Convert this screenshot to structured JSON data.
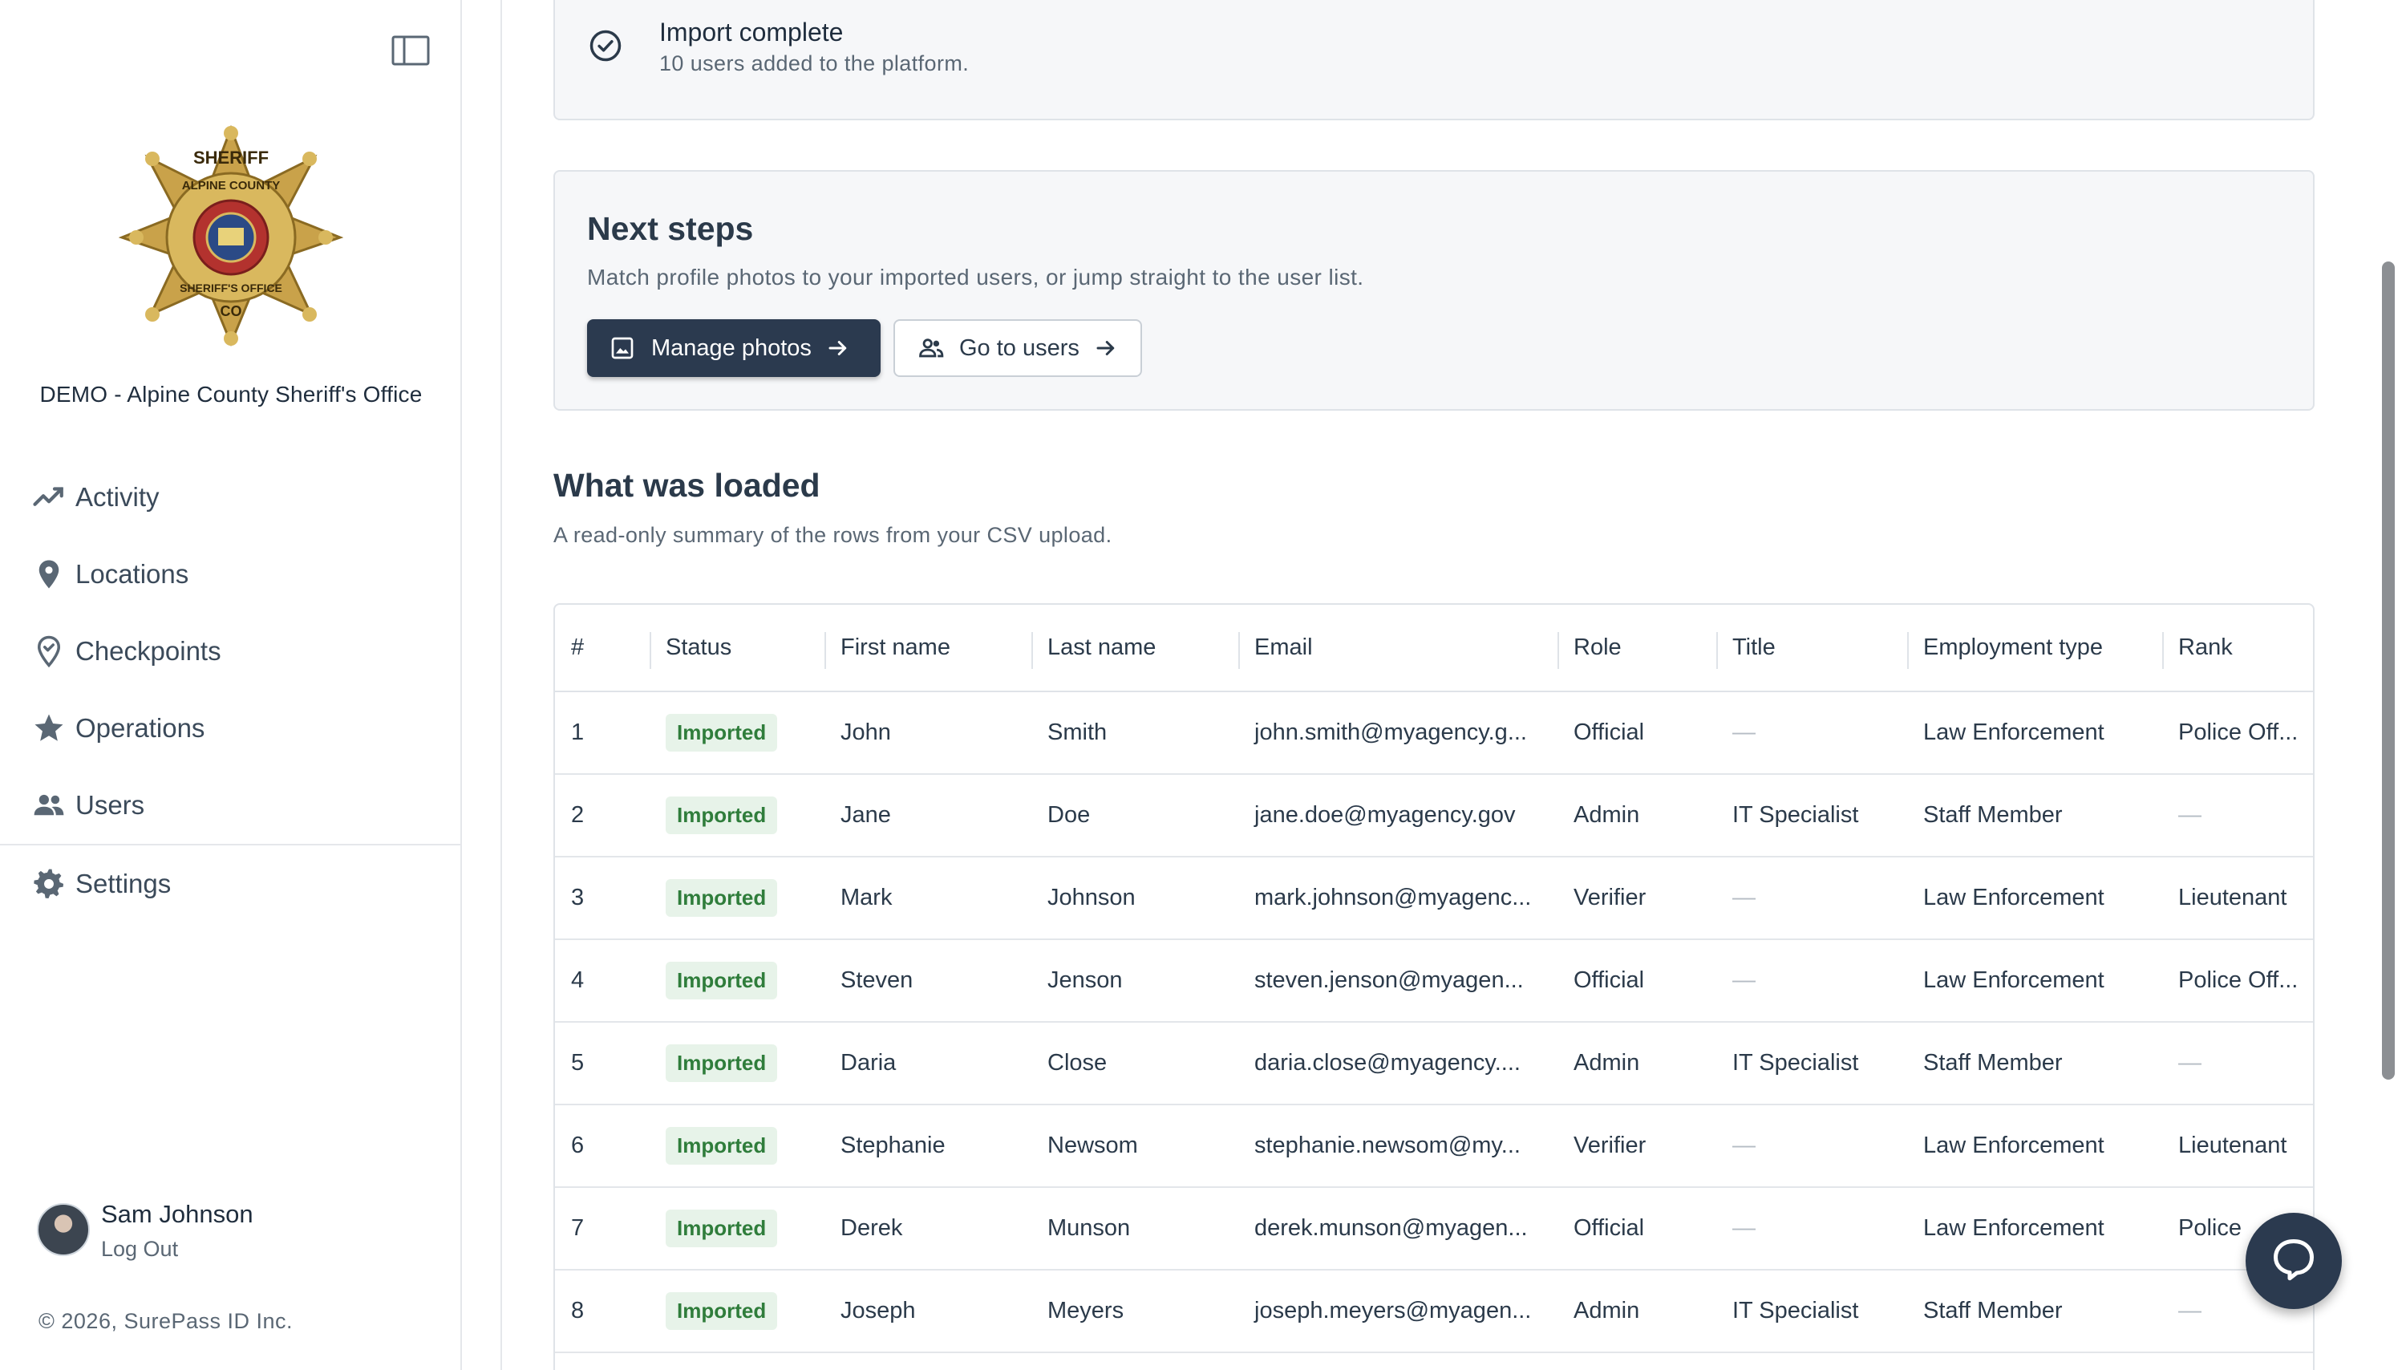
{
  "sidebar": {
    "org_name": "DEMO - Alpine County Sheriff's Office",
    "badge": {
      "top_text": "SHERIFF",
      "county": "ALPINE COUNTY",
      "office": "SHERIFF'S OFFICE",
      "state": "CO"
    },
    "nav": [
      {
        "label": "Activity",
        "icon": "activity-icon"
      },
      {
        "label": "Locations",
        "icon": "location-pin-icon"
      },
      {
        "label": "Checkpoints",
        "icon": "checkpoint-pin-icon"
      },
      {
        "label": "Operations",
        "icon": "star-icon"
      },
      {
        "label": "Users",
        "icon": "users-icon"
      },
      {
        "label": "Settings",
        "icon": "gear-icon"
      }
    ],
    "user": {
      "name": "Sam Johnson",
      "logout": "Log Out"
    },
    "copyright": "© 2026, SurePass ID Inc."
  },
  "import_status": {
    "title": "Import complete",
    "subtitle": "10 users added to the platform."
  },
  "next_steps": {
    "title": "Next steps",
    "subtitle": "Match profile photos to your imported users, or jump straight to the user list.",
    "primary_button": "Manage photos",
    "secondary_button": "Go to users"
  },
  "loaded": {
    "title": "What was loaded",
    "subtitle": "A read-only summary of the rows from your CSV upload."
  },
  "table": {
    "columns": [
      "#",
      "Status",
      "First name",
      "Last name",
      "Email",
      "Role",
      "Title",
      "Employment type",
      "Rank"
    ],
    "rows": [
      [
        "1",
        "Imported",
        "John",
        "Smith",
        "john.smith@myagency.g...",
        "Official",
        "—",
        "Law Enforcement",
        "Police Off..."
      ],
      [
        "2",
        "Imported",
        "Jane",
        "Doe",
        "jane.doe@myagency.gov",
        "Admin",
        "IT Specialist",
        "Staff Member",
        "—"
      ],
      [
        "3",
        "Imported",
        "Mark",
        "Johnson",
        "mark.johnson@myagenc...",
        "Verifier",
        "—",
        "Law Enforcement",
        "Lieutenant"
      ],
      [
        "4",
        "Imported",
        "Steven",
        "Jenson",
        "steven.jenson@myagen...",
        "Official",
        "—",
        "Law Enforcement",
        "Police Off..."
      ],
      [
        "5",
        "Imported",
        "Daria",
        "Close",
        "daria.close@myagency....",
        "Admin",
        "IT Specialist",
        "Staff Member",
        "—"
      ],
      [
        "6",
        "Imported",
        "Stephanie",
        "Newsom",
        "stephanie.newsom@my...",
        "Verifier",
        "—",
        "Law Enforcement",
        "Lieutenant"
      ],
      [
        "7",
        "Imported",
        "Derek",
        "Munson",
        "derek.munson@myagen...",
        "Official",
        "—",
        "Law Enforcement",
        "Police"
      ],
      [
        "8",
        "Imported",
        "Joseph",
        "Meyers",
        "joseph.meyers@myagen...",
        "Admin",
        "IT Specialist",
        "Staff Member",
        "—"
      ]
    ]
  },
  "colors": {
    "primary": "#2b3a4f",
    "status_green": "#2f7d3b",
    "status_bg": "#e7f3e9"
  }
}
